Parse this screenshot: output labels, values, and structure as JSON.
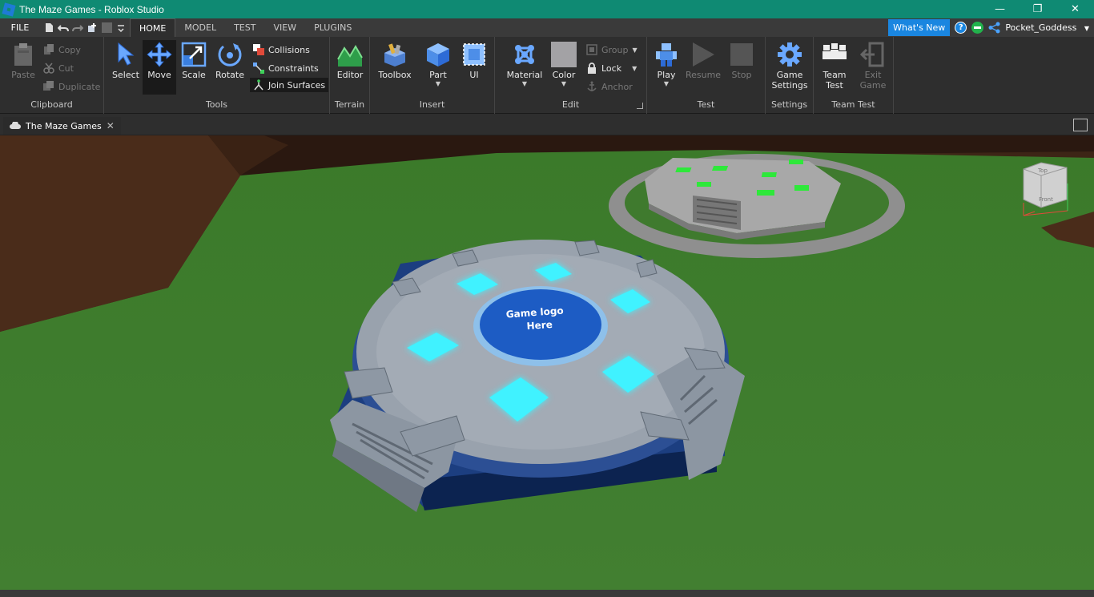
{
  "window": {
    "title": "The Maze Games - Roblox Studio",
    "controls": {
      "minimize": "—",
      "maximize": "❐",
      "close": "✕"
    }
  },
  "menu": {
    "file_label": "FILE",
    "tabs": [
      {
        "label": "HOME",
        "active": true
      },
      {
        "label": "MODEL"
      },
      {
        "label": "TEST"
      },
      {
        "label": "VIEW"
      },
      {
        "label": "PLUGINS"
      }
    ],
    "whats_new_label": "What's New",
    "help_glyph": "?",
    "username": "Pocket_Goddess"
  },
  "ribbon": {
    "clipboard": {
      "group_label": "Clipboard",
      "paste_label": "Paste",
      "copy_label": "Copy",
      "cut_label": "Cut",
      "duplicate_label": "Duplicate"
    },
    "tools": {
      "group_label": "Tools",
      "select_label": "Select",
      "move_label": "Move",
      "scale_label": "Scale",
      "rotate_label": "Rotate",
      "collisions_label": "Collisions",
      "constraints_label": "Constraints",
      "join_surfaces_label": "Join Surfaces"
    },
    "terrain": {
      "group_label": "Terrain",
      "editor_label": "Editor"
    },
    "insert": {
      "group_label": "Insert",
      "toolbox_label": "Toolbox",
      "part_label": "Part",
      "ui_label": "UI"
    },
    "edit": {
      "group_label": "Edit",
      "material_label": "Material",
      "color_label": "Color",
      "group_btn_label": "Group",
      "lock_label": "Lock",
      "anchor_label": "Anchor"
    },
    "test": {
      "group_label": "Test",
      "play_label": "Play",
      "resume_label": "Resume",
      "stop_label": "Stop"
    },
    "settings": {
      "group_label": "Settings",
      "game_settings_line1": "Game",
      "game_settings_line2": "Settings"
    },
    "team_test": {
      "group_label": "Team Test",
      "team_test_line1": "Team",
      "team_test_line2": "Test",
      "exit_game_line1": "Exit",
      "exit_game_line2": "Game"
    }
  },
  "document": {
    "tab_label": "The Maze Games",
    "close_glyph": "✕"
  },
  "viewport": {
    "platform_logo_line1": "Game logo",
    "platform_logo_line2": "Here",
    "view_cube_top": "Top",
    "view_cube_front": "Front"
  },
  "colors": {
    "title_bar": "#0f8a73",
    "accent_blue": "#1a86e0",
    "grass": "#3f7a2e",
    "neon_cyan": "#3ff2ff",
    "neon_green": "#2ee83a",
    "platform_blue": "#1d5cc4"
  }
}
